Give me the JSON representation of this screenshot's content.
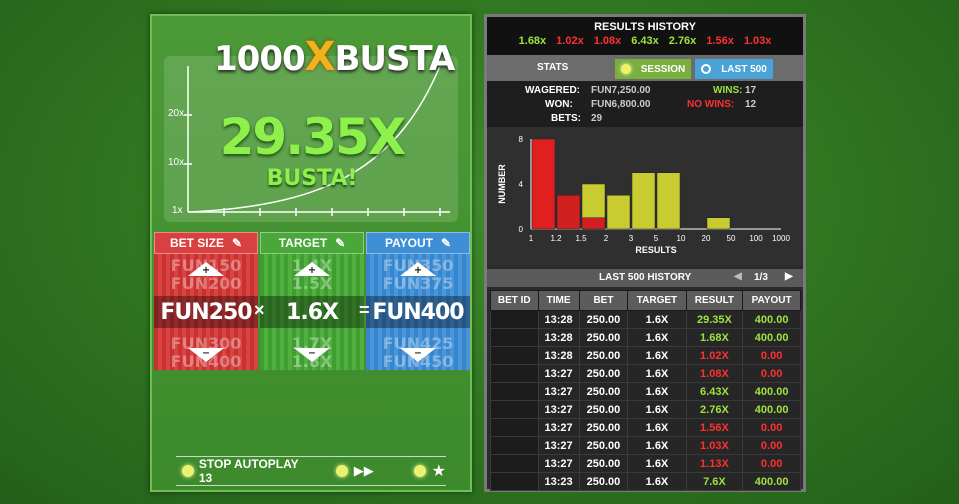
{
  "game": {
    "logo_text_left": "1000",
    "logo_text_x": "X",
    "logo_text_right": "BUSTA",
    "multiplier": "29.35X",
    "status": "BUSTA!",
    "y_ticks": [
      "20x",
      "10x",
      "1x"
    ]
  },
  "bet_columns": {
    "bet_size": {
      "label": "BET SIZE",
      "value": "FUN250",
      "above": [
        "FUN150",
        "FUN200"
      ],
      "below": [
        "FUN300",
        "FUN400"
      ]
    },
    "target": {
      "label": "TARGET",
      "value": "1.6X",
      "above": [
        "1.4X",
        "1.5X"
      ],
      "below": [
        "1.7X",
        "1.8X"
      ]
    },
    "payout": {
      "label": "PAYOUT",
      "value": "FUN400",
      "above": [
        "FUN350",
        "FUN375"
      ],
      "below": [
        "FUN425",
        "FUN450"
      ]
    },
    "multiply_sign": "×",
    "equals_sign": "="
  },
  "autoplay": {
    "label": "STOP AUTOPLAY 13"
  },
  "results": {
    "title": "RESULTS HISTORY",
    "history": [
      {
        "value": "1.68x",
        "win": true
      },
      {
        "value": "1.02x",
        "win": false
      },
      {
        "value": "1.08x",
        "win": false
      },
      {
        "value": "6.43x",
        "win": true
      },
      {
        "value": "2.76x",
        "win": true
      },
      {
        "value": "1.56x",
        "win": false
      },
      {
        "value": "1.03x",
        "win": false
      }
    ],
    "stats_label": "STATS",
    "tab_session": "SESSION",
    "tab_last500": "LAST 500",
    "wagered_label": "WAGERED:",
    "wagered": "FUN7,250.00",
    "won_label": "WON:",
    "won": "FUN6,800.00",
    "bets_label": "BETS:",
    "bets": "29",
    "wins_label": "WINS:",
    "wins": "17",
    "nowins_label": "NO WINS:",
    "nowins": "12",
    "last500_label": "LAST 500 HISTORY",
    "page": "1/3",
    "columns": [
      "BET ID",
      "TIME",
      "BET",
      "TARGET",
      "RESULT",
      "PAYOUT"
    ],
    "rows": [
      {
        "time": "13:28",
        "bet": "250.00",
        "target": "1.6X",
        "result": "29.35X",
        "payout": "400.00",
        "win": true
      },
      {
        "time": "13:28",
        "bet": "250.00",
        "target": "1.6X",
        "result": "1.68X",
        "payout": "400.00",
        "win": true
      },
      {
        "time": "13:28",
        "bet": "250.00",
        "target": "1.6X",
        "result": "1.02X",
        "payout": "0.00",
        "win": false
      },
      {
        "time": "13:27",
        "bet": "250.00",
        "target": "1.6X",
        "result": "1.08X",
        "payout": "0.00",
        "win": false
      },
      {
        "time": "13:27",
        "bet": "250.00",
        "target": "1.6X",
        "result": "6.43X",
        "payout": "400.00",
        "win": true
      },
      {
        "time": "13:27",
        "bet": "250.00",
        "target": "1.6X",
        "result": "2.76X",
        "payout": "400.00",
        "win": true
      },
      {
        "time": "13:27",
        "bet": "250.00",
        "target": "1.6X",
        "result": "1.56X",
        "payout": "0.00",
        "win": false
      },
      {
        "time": "13:27",
        "bet": "250.00",
        "target": "1.6X",
        "result": "1.03X",
        "payout": "0.00",
        "win": false
      },
      {
        "time": "13:27",
        "bet": "250.00",
        "target": "1.6X",
        "result": "1.13X",
        "payout": "0.00",
        "win": false
      },
      {
        "time": "13:23",
        "bet": "250.00",
        "target": "1.6X",
        "result": "7.6X",
        "payout": "400.00",
        "win": true
      }
    ]
  },
  "chart_data": {
    "type": "bar",
    "xlabel": "RESULTS",
    "ylabel": "NUMBER",
    "ylim": [
      0,
      8
    ],
    "y_ticks": [
      "0",
      "4",
      "8"
    ],
    "x_ticks": [
      "1",
      "1.2",
      "1.5",
      "2",
      "3",
      "5",
      "10",
      "20",
      "50",
      "100",
      "1000"
    ],
    "bins": [
      {
        "range": "1-1.2",
        "value": 8,
        "color": "#e02020"
      },
      {
        "range": "1.2-1.5",
        "value": 3,
        "color": "#d22020"
      },
      {
        "range": "1.5-2",
        "value": 4,
        "color": "#c8cc30",
        "overlay_red": 1
      },
      {
        "range": "2-3",
        "value": 3,
        "color": "#c8cc30"
      },
      {
        "range": "3-5",
        "value": 5,
        "color": "#c8cc30"
      },
      {
        "range": "5-10",
        "value": 5,
        "color": "#c8cc30"
      },
      {
        "range": "10-20",
        "value": 0,
        "color": "#c8cc30"
      },
      {
        "range": "20-50",
        "value": 1,
        "color": "#c8cc30"
      },
      {
        "range": "50-100",
        "value": 0,
        "color": "#c8cc30"
      },
      {
        "range": "100-1000",
        "value": 0,
        "color": "#c8cc30"
      }
    ]
  }
}
